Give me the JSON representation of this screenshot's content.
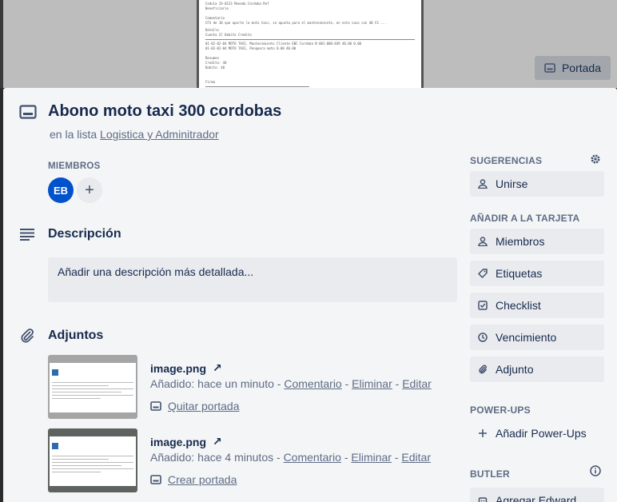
{
  "cover": {
    "button_label": "Portada",
    "doc_lines": [
      "Cedula   IX-0123     Moneda   Cordoba        Ref",
      "Beneficiario",
      "Comentario",
      "CFS de 10 que aporte la moto taxi, se apunta para el mantenimiento, en este caso con 40 CS ...",
      "Detalle",
      "Cuenta                                 CC            Debito      Credito",
      "01-02-02-04 MOTO TAXI, Mantenimiento Cliente EBC Cordoba N 001-000-039    40.00      0.00",
      "01-02-02-04 MOTO TAXI, Ponquera moto                                        0.00     40.00",
      "Resumen",
      "Credito:    40",
      "Debito:     40",
      "Firma"
    ]
  },
  "card": {
    "title": "Abono moto taxi 300 cordobas",
    "list_prefix": "en la lista",
    "list_name": "Logistica y Adminitrador"
  },
  "members": {
    "heading": "MIEMBROS",
    "avatar_initials": "EB",
    "add_symbol": "+"
  },
  "description": {
    "heading": "Descripción",
    "placeholder": "Añadir una descripción más detallada..."
  },
  "attachments": {
    "heading": "Adjuntos",
    "items": [
      {
        "name": "image.png",
        "arrow": "↗",
        "added": "Añadido: hace un minuto",
        "comment": "Comentario",
        "delete": "Eliminar",
        "edit": "Editar",
        "sep": " - ",
        "cover_action": "Quitar portada",
        "thumb_bg": "#a5a5a5"
      },
      {
        "name": "image.png",
        "arrow": "↗",
        "added": "Añadido: hace 4 minutos",
        "comment": "Comentario",
        "delete": "Eliminar",
        "edit": "Editar",
        "sep": " - ",
        "cover_action": "Crear portada",
        "thumb_bg": "#5e6360"
      }
    ]
  },
  "sidebar": {
    "suggestions_heading": "SUGERENCIAS",
    "join": "Unirse",
    "add_heading": "AÑADIR A LA TARJETA",
    "members": "Miembros",
    "labels": "Etiquetas",
    "checklist": "Checklist",
    "due": "Vencimiento",
    "attachment": "Adjunto",
    "powerups_heading": "POWER-UPS",
    "add_powerups": "Añadir Power-Ups",
    "butler_heading": "BUTLER",
    "butler_button": "Agregar Edward"
  },
  "colors": {
    "panel": "#f4f5f7",
    "avatar": "#0052cc",
    "button": "#e9ebef",
    "text": "#172b4d",
    "muted": "#5e6c84"
  }
}
